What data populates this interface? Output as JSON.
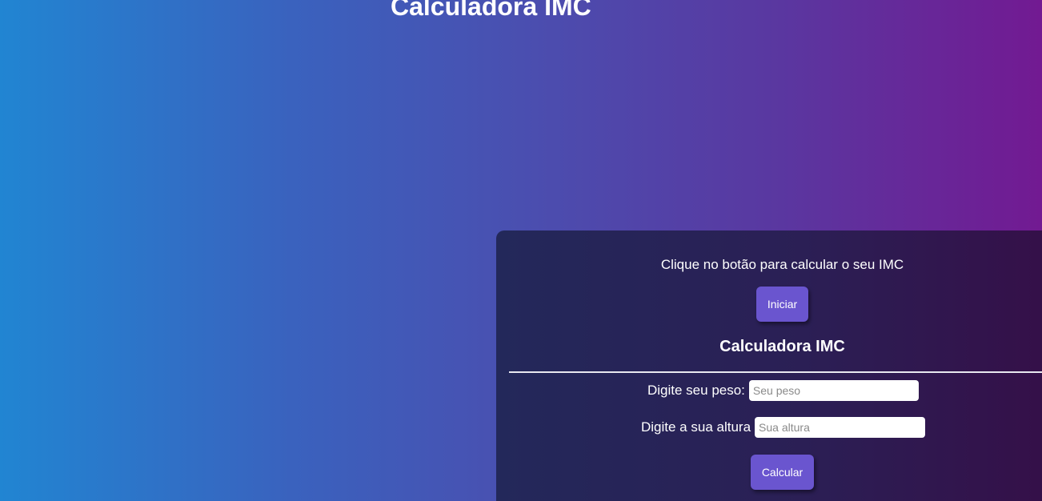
{
  "page": {
    "title": "Calculadora IMC"
  },
  "panel": {
    "intro_text": "Clique no botão para calcular o seu IMC",
    "start_button_label": "Iniciar",
    "heading": "Calculadora IMC",
    "weight": {
      "label": "Digite seu peso:",
      "placeholder": "Seu peso",
      "value": ""
    },
    "height": {
      "label": "Digite a sua altura",
      "placeholder": "Sua altura",
      "value": ""
    },
    "calculate_button_label": "Calcular"
  },
  "colors": {
    "background_gradient": [
      "#2185d2",
      "#4a4fb0",
      "#721a92"
    ],
    "panel_gradient": [
      "#23285a",
      "#350f48"
    ],
    "button": "#6a55cf",
    "text": "#ffffff"
  }
}
